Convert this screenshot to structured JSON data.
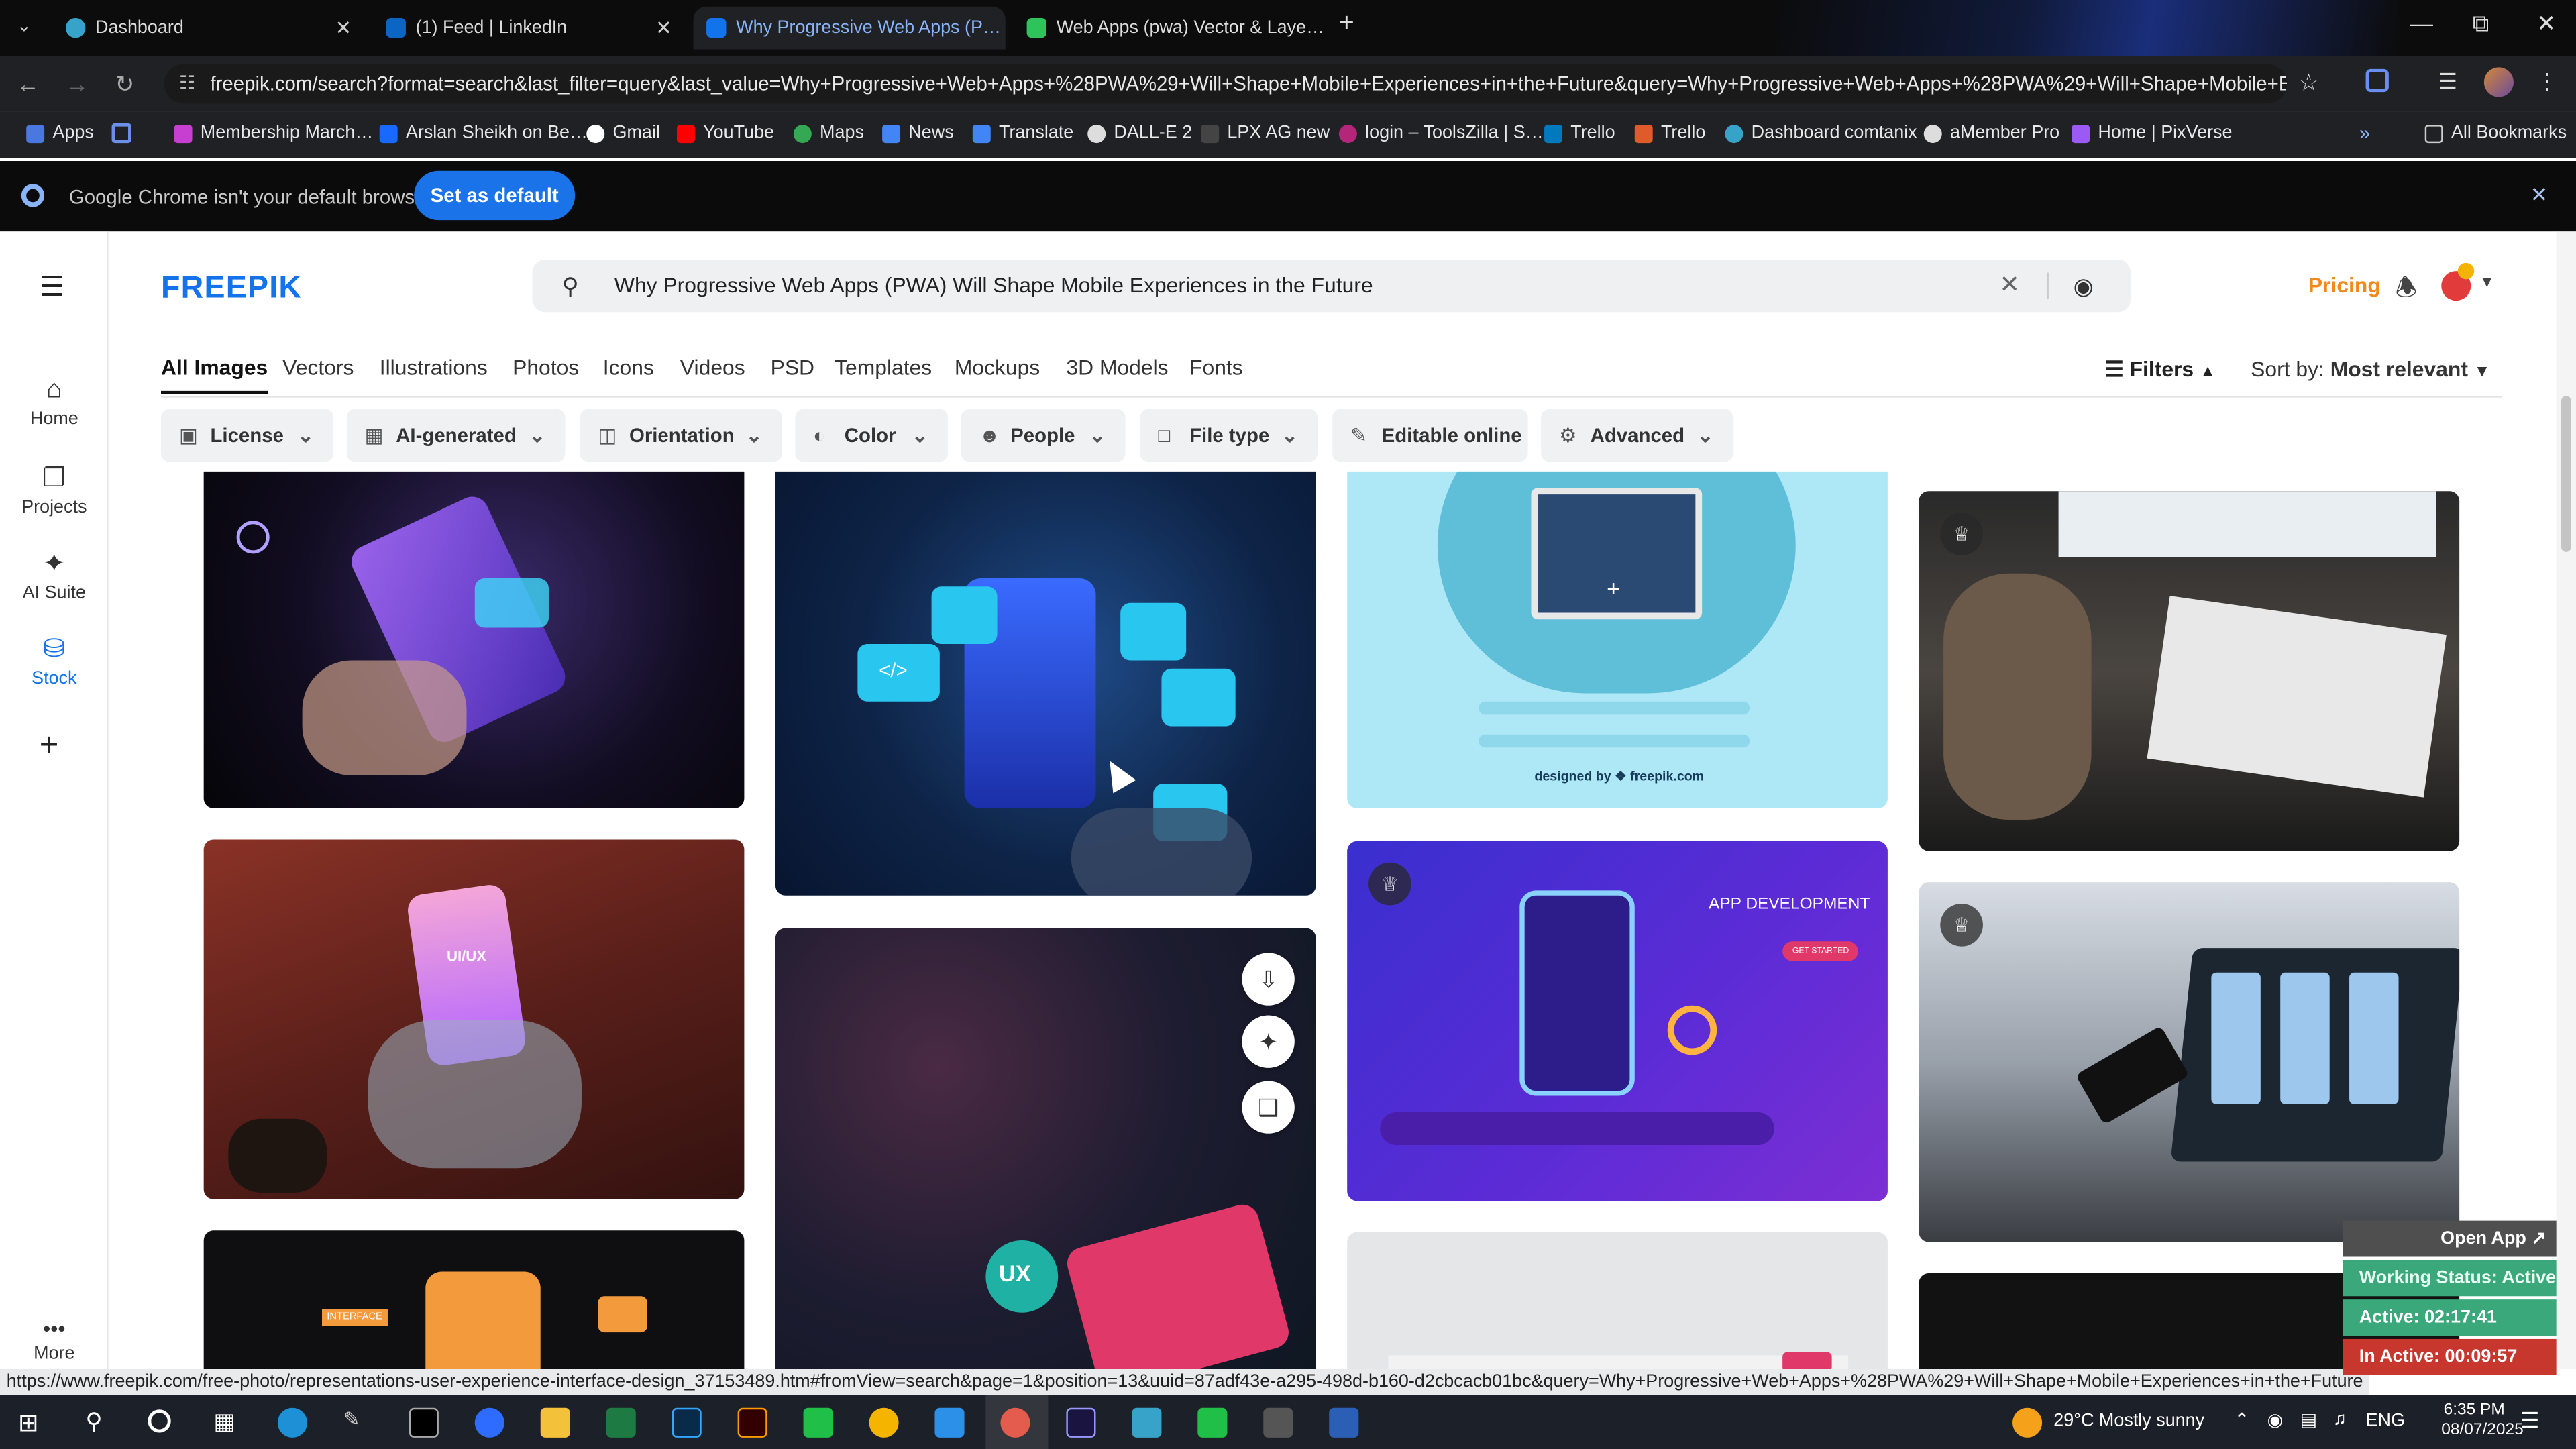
{
  "browser": {
    "tabs": [
      {
        "title": "Dashboard",
        "active": false
      },
      {
        "title": "(1) Feed | LinkedIn",
        "active": false
      },
      {
        "title": "Why Progressive Web Apps (P…",
        "active": true
      },
      {
        "title": "Web Apps (pwa) Vector & Laye…",
        "active": false
      }
    ],
    "url": "freepik.com/search?format=search&last_filter=query&last_value=Why+Progressive+Web+Apps+%28PWA%29+Will+Shape+Mobile+Experiences+in+the+Future&query=Why+Progressive+Web+Apps+%28PWA%29+Will+Shape+Mobile+Experien…",
    "bookmarks": [
      "Apps",
      "Membership March…",
      "Arslan Sheikh on Be…",
      "Gmail",
      "YouTube",
      "Maps",
      "News",
      "Translate",
      "DALL-E 2",
      "LPX AG new",
      "login – ToolsZilla | S…",
      "Trello",
      "Trello",
      "Dashboard comtanix",
      "aMember Pro",
      "Home | PixVerse"
    ],
    "all_bookmarks": "All Bookmarks",
    "notice_text": "Google Chrome isn't your default browser",
    "set_default_label": "Set as default"
  },
  "site": {
    "logo": "FREEPIK",
    "search_query": "Why Progressive Web Apps (PWA) Will Shape Mobile Experiences in the Future",
    "pricing": "Pricing",
    "left_nav": [
      "Home",
      "Projects",
      "AI Suite",
      "Stock",
      "More"
    ],
    "categories": [
      "All Images",
      "Vectors",
      "Illustrations",
      "Photos",
      "Icons",
      "Videos",
      "PSD",
      "Templates",
      "Mockups",
      "3D Models",
      "Fonts"
    ],
    "filters_label": "Filters",
    "sort_label": "Sort by:",
    "sort_value": "Most relevant",
    "filters": [
      "License",
      "AI-generated",
      "Orientation",
      "Color",
      "People",
      "File type",
      "Editable online",
      "Advanced"
    ],
    "card_texts": {
      "designed_by": "designed by ❖ freepik.com",
      "app_development": "APP DEVELOPMENT",
      "get_started": "GET STARTED",
      "uiux": "UI/UX",
      "ux": "UX",
      "interface": "INTERFACE"
    }
  },
  "status_url": "https://www.freepik.com/free-photo/representations-user-experience-interface-design_37153489.htm#fromView=search&page=1&position=13&uuid=87adf43e-a295-498d-b160-d2cbcacb01bc&query=Why+Progressive+Web+Apps+%28PWA%29+Will+Shape+Mobile+Experiences+in+the+Future",
  "tracker": {
    "open_app": "Open App ↗",
    "working": "Working Status: Active",
    "active": "Active: 02:17:41",
    "inactive": "In Active: 00:09:57"
  },
  "taskbar": {
    "weather": "29°C  Mostly sunny",
    "lang": "ENG",
    "time": "6:35 PM",
    "date": "08/07/2025"
  },
  "colors": {
    "freepik_blue": "#1273eb",
    "pricing_orange": "#f08a1c",
    "chrome_blue": "#1a73e8"
  }
}
